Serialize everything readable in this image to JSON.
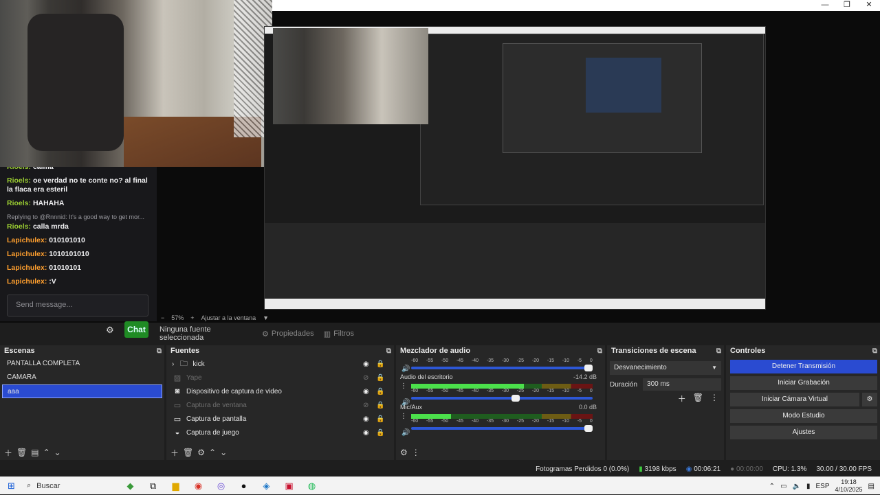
{
  "window": {
    "minimize": "—",
    "restore": "❐",
    "close": "✕"
  },
  "chat": {
    "lines": [
      {
        "user": "Rioels:",
        "text": "calma",
        "color": "green"
      },
      {
        "user": "Rioels:",
        "text": "oe verdad no te conte no? al final la flaca era esteril",
        "color": "green"
      },
      {
        "user": "Rioels:",
        "text": "HAHAHA",
        "color": "green"
      },
      {
        "reply": "Replying to @Rnnnid: It's a good way to get mor...",
        "user": "Rioels:",
        "text": "calla mrda",
        "color": "green"
      },
      {
        "user": "Lapichulex:",
        "text": "010101010",
        "color": "orange"
      },
      {
        "user": "Lapichulex:",
        "text": "1010101010",
        "color": "orange"
      },
      {
        "user": "Lapichulex:",
        "text": "01010101",
        "color": "orange"
      },
      {
        "user": "Lapichulex:",
        "text": ":V",
        "color": "orange"
      }
    ],
    "placeholder": "Send message...",
    "send_label": "Chat"
  },
  "preview_toolbar": {
    "zoom": "57%",
    "fit": "Ajustar a la ventana"
  },
  "source_toolbar": {
    "no_source": "Ninguna fuente seleccionada",
    "properties": "Propiedades",
    "filters": "Filtros"
  },
  "scenes": {
    "title": "Escenas",
    "items": [
      {
        "label": "PANTALLA COMPLETA",
        "selected": false
      },
      {
        "label": "CAMARA",
        "selected": false
      },
      {
        "label": "aaa",
        "selected": true
      }
    ]
  },
  "sources": {
    "title": "Fuentes",
    "items": [
      {
        "label": "kick",
        "icon": "folder-icon",
        "visible": true,
        "dim": false,
        "group": true
      },
      {
        "label": "Yape",
        "icon": "image-icon",
        "visible": false,
        "dim": true
      },
      {
        "label": "Dispositivo de captura de video",
        "icon": "camera-icon",
        "visible": true,
        "dim": false
      },
      {
        "label": "Captura de ventana",
        "icon": "window-icon",
        "visible": false,
        "dim": true
      },
      {
        "label": "Captura de pantalla",
        "icon": "monitor-icon",
        "visible": true,
        "dim": false
      },
      {
        "label": "Captura de juego",
        "icon": "gamepad-icon",
        "visible": true,
        "dim": false
      }
    ]
  },
  "mixer": {
    "title": "Mezclador de audio",
    "scale": [
      "-60",
      "-55",
      "-50",
      "-45",
      "-40",
      "-35",
      "-30",
      "-25",
      "-20",
      "-15",
      "-10",
      "-5",
      "0"
    ],
    "channels": [
      {
        "name": "",
        "db": "",
        "level": 0.0,
        "fader": 1.0
      },
      {
        "name": "Audio del escritorio",
        "db": "-14.2 dB",
        "level": 0.62,
        "fader": 0.6
      },
      {
        "name": "Mic/Aux",
        "db": "0.0 dB",
        "level": 0.22,
        "fader": 1.0
      }
    ]
  },
  "transitions": {
    "title": "Transiciones de escena",
    "selected": "Desvanecimiento",
    "duration_label": "Duración",
    "duration_value": "300 ms"
  },
  "controls": {
    "title": "Controles",
    "buttons": [
      "Detener Transmisión",
      "Iniciar Grabación",
      "Iniciar Cámara Virtual",
      "Modo Estudio",
      "Ajustes"
    ]
  },
  "status": {
    "dropped": "Fotogramas Perdidos 0 (0.0%)",
    "bitrate": "3198 kbps",
    "stream_time": "00:06:21",
    "rec_time": "00:00:00",
    "cpu": "CPU: 1.3%",
    "fps": "30.00 / 30.00 FPS"
  },
  "taskbar": {
    "search": "Buscar",
    "lang": "ESP",
    "time": "19:18",
    "date": "4/10/2025"
  },
  "colors": {
    "accent": "#2a4bd1",
    "chat_green": "#9acd32",
    "chat_orange": "#ff9f2e",
    "send_button": "#1f8b24"
  }
}
